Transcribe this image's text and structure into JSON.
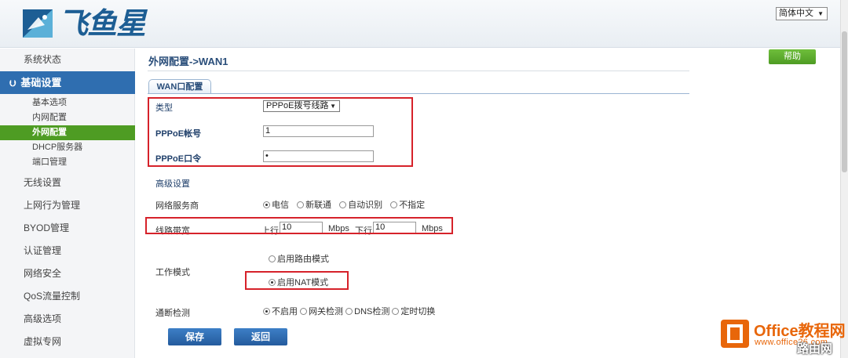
{
  "brand": {
    "name": "飞鱼星"
  },
  "language": {
    "selected": "简体中文"
  },
  "sidebar": {
    "items_top": [
      {
        "label": "系统状态"
      }
    ],
    "group": {
      "label": "基础设置"
    },
    "sub_items": [
      {
        "label": "基本选项",
        "active": false
      },
      {
        "label": "内网配置",
        "active": false
      },
      {
        "label": "外网配置",
        "active": true
      },
      {
        "label": "DHCP服务器",
        "active": false
      },
      {
        "label": "端口管理",
        "active": false
      }
    ],
    "items_bottom": [
      {
        "label": "无线设置"
      },
      {
        "label": "上网行为管理"
      },
      {
        "label": "BYOD管理"
      },
      {
        "label": "认证管理"
      },
      {
        "label": "网络安全"
      },
      {
        "label": "QoS流量控制"
      },
      {
        "label": "高级选项"
      },
      {
        "label": "虚拟专网"
      }
    ]
  },
  "main": {
    "breadcrumb": "外网配置->WAN1",
    "help_label": "帮助",
    "tab_label": "WAN口配置",
    "type": {
      "label": "类型",
      "value": "PPPoE拨号线路"
    },
    "account": {
      "label": "PPPoE帐号",
      "value": "1"
    },
    "password": {
      "label": "PPPoE口令",
      "value": "•"
    },
    "advanced_label": "高级设置",
    "isp": {
      "label": "网络服务商",
      "options": [
        {
          "label": "电信",
          "selected": true
        },
        {
          "label": "新联通",
          "selected": false
        },
        {
          "label": "自动识别",
          "selected": false
        },
        {
          "label": "不指定",
          "selected": false
        }
      ]
    },
    "bandwidth": {
      "label": "线路带宽",
      "up_label": "上行:",
      "up_value": "10",
      "up_unit": "Mbps",
      "down_label": "下行:",
      "down_value": "10",
      "down_unit": "Mbps"
    },
    "work_mode": {
      "label": "工作模式",
      "options": [
        {
          "label": "启用路由模式",
          "selected": false
        },
        {
          "label": "启用NAT模式",
          "selected": true
        }
      ]
    },
    "detect": {
      "label": "通断检测",
      "options": [
        {
          "label": "不启用",
          "selected": true
        },
        {
          "label": "网关检测",
          "selected": false
        },
        {
          "label": "DNS检测",
          "selected": false
        },
        {
          "label": "定时切换",
          "selected": false
        }
      ]
    },
    "save_label": "保存",
    "back_label": "返回"
  },
  "watermark": {
    "title": "Office教程网",
    "url": "www.office26.com",
    "corner": "路由网"
  },
  "colors": {
    "nav_group_bg": "#2f6eb0",
    "nav_active_bg": "#4e9c23",
    "help_bg": "#4e9c23",
    "button_bg": "#2a67ad",
    "highlight_red": "#d6222a",
    "watermark_orange": "#e8660a"
  }
}
